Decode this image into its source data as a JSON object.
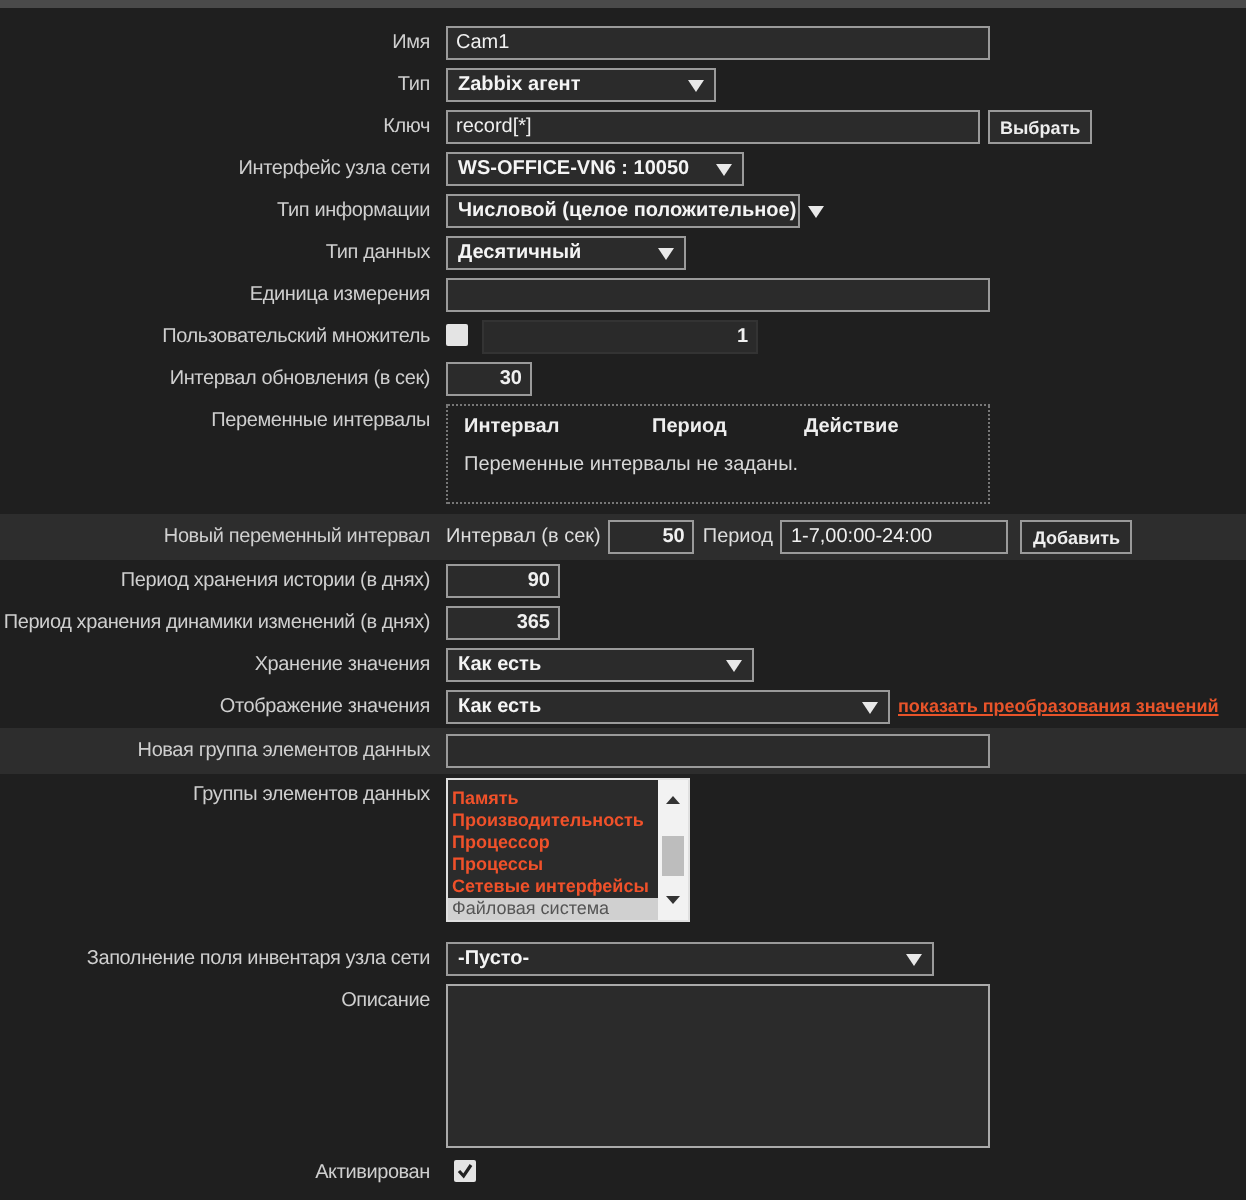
{
  "rows": [
    {
      "kind": "text",
      "label": "Имя",
      "value": "Cam1",
      "highlighted": false
    },
    {
      "kind": "select",
      "label": "Тип",
      "value": "Zabbix агент",
      "highlighted": false
    },
    {
      "kind": "text_button",
      "label": "Ключ",
      "value": "record[*]",
      "button": "Выбрать",
      "highlighted": false
    },
    {
      "kind": "select",
      "label": "Интерфейс узла сети",
      "value": "WS-OFFICE-VN6 : 10050",
      "highlighted": false
    },
    {
      "kind": "select",
      "label": "Тип информации",
      "value": "Числовой (целое положительное)",
      "highlighted": false
    },
    {
      "kind": "select",
      "label": "Тип данных",
      "value": "Десятичный",
      "highlighted": false
    },
    {
      "kind": "text",
      "label": "Единица измерения",
      "highlighted": false
    },
    {
      "kind": "multiplier",
      "label": "Пользовательский множитель",
      "checked": false,
      "value": "1",
      "highlighted": false
    },
    {
      "kind": "number",
      "label": "Интервал обновления (в сек)",
      "value": "30",
      "highlighted": false
    },
    {
      "kind": "intervals",
      "label": "Переменные интервалы",
      "columns": [
        "Интервал",
        "Период",
        "Действие"
      ],
      "message": "Переменные интервалы не заданы.",
      "highlighted": false
    },
    {
      "kind": "new_interval",
      "label": "Новый переменный интервал",
      "interval_label": "Интервал (в сек)",
      "interval": "50",
      "period_label": "Период",
      "period": "1-7,00:00-24:00",
      "button": "Добавить",
      "highlighted": true
    },
    {
      "kind": "number",
      "label": "Период хранения истории (в днях)",
      "value": "90",
      "highlighted": false
    },
    {
      "kind": "number",
      "label": "Период хранения динамики изменений (в днях)",
      "value": "365",
      "highlighted": false
    },
    {
      "kind": "select",
      "label": "Хранение значения",
      "value": "Как есть",
      "highlighted": false
    },
    {
      "kind": "select",
      "label": "Отображение значения",
      "value": "Как есть",
      "link": "показать преобразования значений",
      "highlighted": false
    },
    {
      "kind": "text",
      "label": "Новая группа элементов данных",
      "highlighted": true
    },
    {
      "kind": "listbox",
      "label": "Группы элементов данных",
      "highlighted": false,
      "items": [
        {
          "text": "Память",
          "selected": false
        },
        {
          "text": "Производительность",
          "selected": false
        },
        {
          "text": "Процессор",
          "selected": false
        },
        {
          "text": "Процессы",
          "selected": false
        },
        {
          "text": "Сетевые интерфейсы",
          "selected": false
        },
        {
          "text": "Файловая система",
          "selected": true
        }
      ]
    },
    {
      "kind": "select",
      "label": "Заполнение поля инвентаря узла сети",
      "value": "-Пусто-",
      "highlighted": false
    },
    {
      "kind": "textarea",
      "label": "Описание",
      "highlighted": false
    },
    {
      "kind": "checkbox",
      "label": "Активирован",
      "checked": true,
      "highlighted": false
    }
  ]
}
